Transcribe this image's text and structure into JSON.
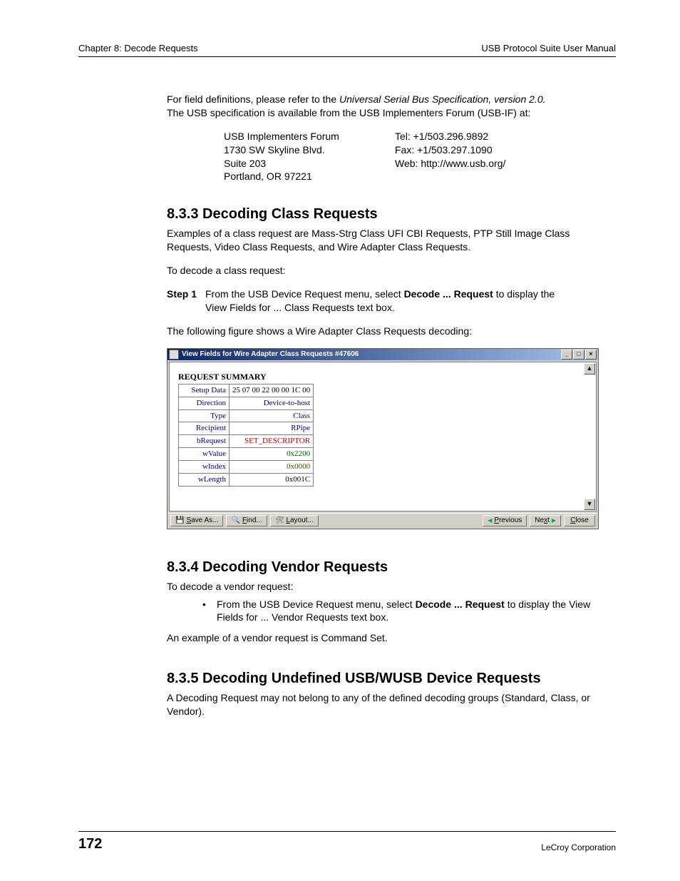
{
  "header": {
    "left": "Chapter 8: Decode Requests",
    "right": "USB Protocol Suite User Manual"
  },
  "intro": {
    "line1a": "For field definitions, please refer to the ",
    "line1b": "Universal Serial Bus Specification, version 2.0.",
    "line2": "The USB specification is available from the USB Implementers Forum (USB-IF) at:"
  },
  "address": {
    "org": "USB Implementers Forum",
    "street": "1730 SW Skyline Blvd.",
    "suite": "Suite 203",
    "city": "Portland, OR 97221",
    "tel": "Tel: +1/503.296.9892",
    "fax": "Fax: +1/503.297.1090",
    "web": "Web: http://www.usb.org/"
  },
  "s833": {
    "heading": "8.3.3 Decoding Class Requests",
    "p1": "Examples of a class request are Mass-Strg Class UFI CBI Requests, PTP Still Image Class Requests, Video Class Requests, and Wire Adapter Class Requests.",
    "p2": "To decode a class request:",
    "step_label": "Step 1",
    "step_a": "From the USB Device Request menu, select ",
    "step_b": "Decode ... Request",
    "step_c": " to display the View Fields for ... Class Requests text box.",
    "p3": "The following figure shows a Wire Adapter Class Requests decoding:"
  },
  "window": {
    "title": "View Fields for Wire Adapter Class Requests #47606",
    "summary_heading": "REQUEST SUMMARY",
    "rows": [
      {
        "k": "Setup Data",
        "v": "25 07 00 22 00 00 1C 00",
        "cls": "v-black"
      },
      {
        "k": "Direction",
        "v": "Device-to-host",
        "cls": "v-blue"
      },
      {
        "k": "Type",
        "v": "Class",
        "cls": "v-blue"
      },
      {
        "k": "Recipient",
        "v": "RPipe",
        "cls": "v-blue"
      },
      {
        "k": "bRequest",
        "v": "SET_DESCRIPTOR",
        "cls": "v-red"
      },
      {
        "k": "wValue",
        "v": "0x2200",
        "cls": "v-green"
      },
      {
        "k": "wIndex",
        "v": "0x0000",
        "cls": "v-brown"
      },
      {
        "k": "wLength",
        "v": "0x001C",
        "cls": "v-black"
      }
    ],
    "buttons": {
      "save_ul": "S",
      "save_rest": "ave As...",
      "find_ul": "F",
      "find_rest": "ind...",
      "layout_ul": "L",
      "layout_rest": "ayout...",
      "prev_ul": "P",
      "prev_rest": "revious",
      "next_pre": "Ne",
      "next_ul": "x",
      "next_post": "t",
      "close_ul": "C",
      "close_rest": "lose"
    }
  },
  "s834": {
    "heading": "8.3.4 Decoding Vendor Requests",
    "p1": "To decode a vendor request:",
    "bullet_a": "From the USB Device Request menu, select ",
    "bullet_b": "Decode ... Request",
    "bullet_c": " to display the View Fields for ... Vendor Requests text box.",
    "p2": "An example of a vendor request is Command Set."
  },
  "s835": {
    "heading": "8.3.5 Decoding Undefined USB/WUSB Device Requests",
    "p1": "A Decoding Request may not belong to any of the defined decoding groups (Standard, Class, or Vendor)."
  },
  "footer": {
    "page": "172",
    "corp": "LeCroy Corporation"
  }
}
